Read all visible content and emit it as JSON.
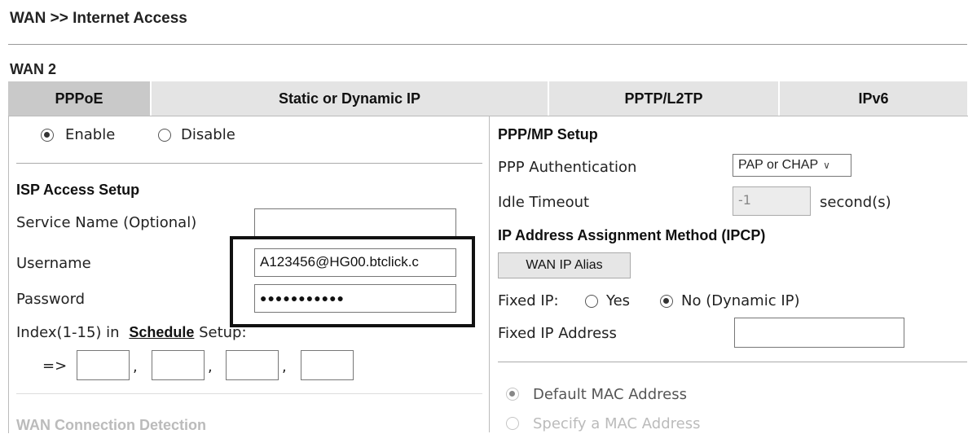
{
  "page": {
    "title": "WAN >> Internet Access"
  },
  "wan_label": "WAN 2",
  "tabs": [
    {
      "label": "PPPoE",
      "active": true
    },
    {
      "label": "Static or Dynamic IP",
      "active": false
    },
    {
      "label": "PPTP/L2TP",
      "active": false
    },
    {
      "label": "IPv6",
      "active": false
    }
  ],
  "enable": {
    "enable_label": "Enable",
    "disable_label": "Disable",
    "selected": "Enable"
  },
  "isp": {
    "section_title": "ISP Access Setup",
    "service_name_label": "Service Name (Optional)",
    "service_name_value": "",
    "username_label": "Username",
    "username_value": "A123456@HG00.btclick.c",
    "password_label": "Password",
    "password_value": "●●●●●●●●●●●",
    "index_prefix": "Index(1-15) in",
    "schedule_link": "Schedule",
    "setup_suffix": "Setup:",
    "arrow": "=>",
    "comma": ","
  },
  "wan_detection_label": "WAN Connection Detection",
  "ppp": {
    "section_title": "PPP/MP Setup",
    "auth_label": "PPP Authentication",
    "auth_value": "PAP or CHAP",
    "idle_label": "Idle Timeout",
    "idle_value": "-1",
    "idle_unit": "second(s)"
  },
  "ipcp": {
    "section_title": "IP Address Assignment Method (IPCP)",
    "alias_button": "WAN IP Alias",
    "fixed_ip_label": "Fixed IP:",
    "yes_label": "Yes",
    "no_label": "No (Dynamic IP)",
    "selected": "No",
    "fixed_addr_label": "Fixed IP Address",
    "fixed_addr_value": ""
  },
  "mac": {
    "default_label": "Default MAC Address",
    "specify_label": "Specify a MAC Address",
    "selected": "Default"
  }
}
